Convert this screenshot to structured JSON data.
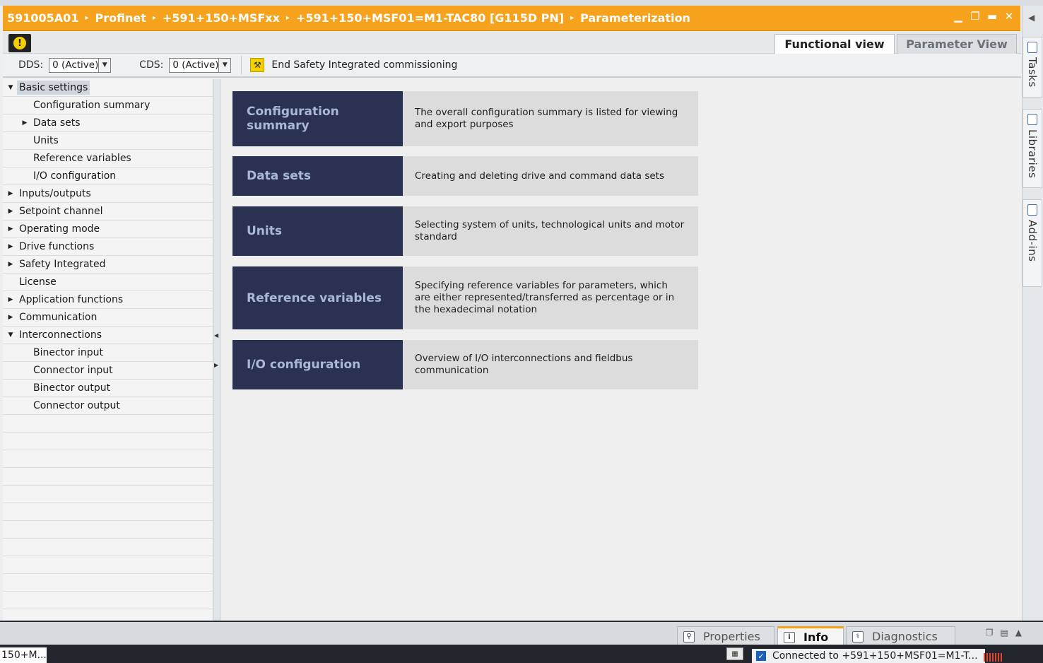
{
  "title_bar": {
    "breadcrumb": [
      "591005A01",
      "Profinet",
      "+591+150+MSFxx",
      "+591+150+MSF01=M1-TAC80 [G115D PN]",
      "Parameterization"
    ],
    "color": "#f7a21d"
  },
  "view_tabs": [
    {
      "label": "Functional view",
      "active": true
    },
    {
      "label": "Parameter View",
      "active": false
    }
  ],
  "param_bar": {
    "dds_label": "DDS:",
    "dds_value": "0 (Active)",
    "cds_label": "CDS:",
    "cds_value": "0 (Active)",
    "safety_action": "End Safety Integrated commissioning"
  },
  "sidebar_tabs": [
    {
      "label": "Tasks",
      "icon": "tasks-icon"
    },
    {
      "label": "Libraries",
      "icon": "libraries-icon"
    },
    {
      "label": "Add-ins",
      "icon": "add-ins-icon"
    }
  ],
  "tree": {
    "basic_settings": "Basic settings",
    "configuration_summary": "Configuration summary",
    "data_sets": "Data sets",
    "units": "Units",
    "reference_variables": "Reference variables",
    "io_configuration": "I/O configuration",
    "inputs_outputs": "Inputs/outputs",
    "setpoint_channel": "Setpoint channel",
    "operating_mode": "Operating mode",
    "drive_functions": "Drive functions",
    "safety_integrated": "Safety Integrated",
    "license": "License",
    "application_functions": "Application functions",
    "communication": "Communication",
    "interconnections": "Interconnections",
    "binector_input": "Binector input",
    "connector_input": "Connector input",
    "binector_output": "Binector output",
    "connector_output": "Connector output"
  },
  "cards": [
    {
      "title": "Configuration summary",
      "description": "The overall configuration summary is listed for viewing and export purposes"
    },
    {
      "title": "Data sets",
      "description": "Creating and deleting drive and command data sets"
    },
    {
      "title": "Units",
      "description": "Selecting system of units, technological units and motor standard"
    },
    {
      "title": "Reference variables",
      "description": "Specifying reference variables for parameters, which are either represented/transferred as percentage or in the hexadecimal notation"
    },
    {
      "title": "I/O configuration",
      "description": "Overview of I/O interconnections and fieldbus communication"
    }
  ],
  "bottom_tabs": [
    {
      "label": "Properties",
      "active": false
    },
    {
      "label": "Info",
      "active": true
    },
    {
      "label": "Diagnostics",
      "active": false
    }
  ],
  "status_bar": {
    "task_item": "150+M...",
    "connection_text": "Connected to +591+150+MSF01=M1-T..."
  },
  "accent_colors": {
    "card_title_bg": "#2b3150",
    "card_title_text": "#a7b8d8",
    "card_desc_bg": "#dcdcdc"
  }
}
